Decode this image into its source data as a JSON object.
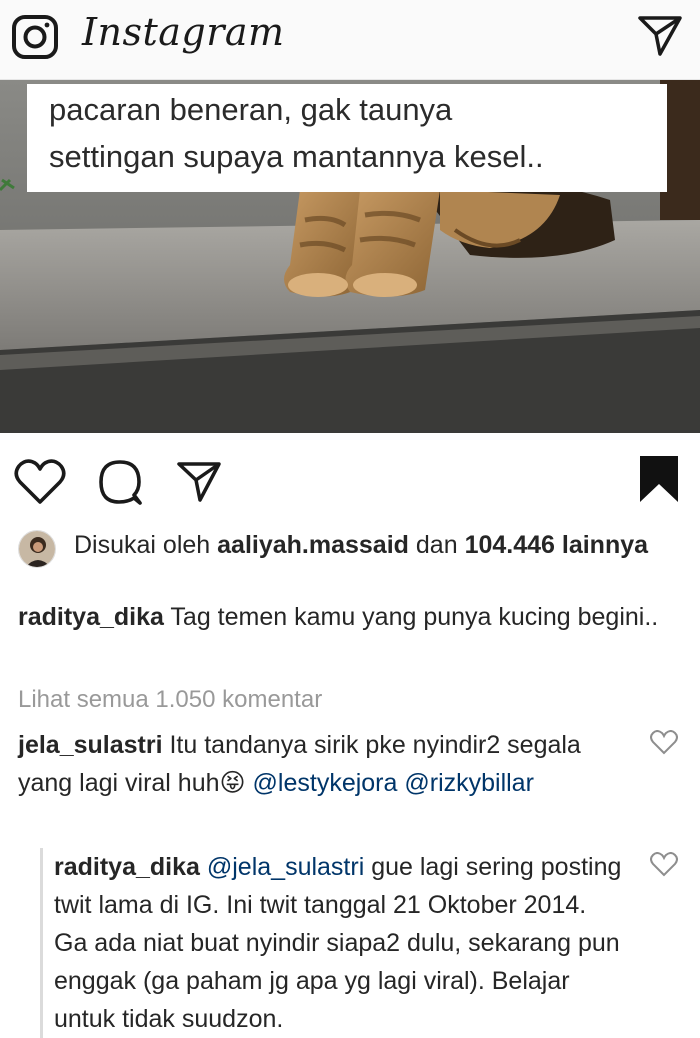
{
  "app": {
    "title": "Instagram"
  },
  "icons": {
    "camera": "camera-icon",
    "direct": "paper-plane-icon",
    "like": "heart-icon",
    "comment": "comment-bubble-icon",
    "share": "paper-plane-icon",
    "save": "bookmark-icon"
  },
  "post": {
    "image_text": [
      "pacaran beneran, gak taunya",
      "settingan supaya mantannya kesel.."
    ]
  },
  "likes": {
    "prefix": "Disukai oleh",
    "user": "aaliyah.massaid",
    "conj": "dan",
    "count": "104.446",
    "suffix": "lainnya"
  },
  "caption": {
    "user": "raditya_dika",
    "text": "Tag temen kamu yang punya kucing begini.."
  },
  "view_all": "Lihat semua 1.050 komentar",
  "comments": [
    {
      "user": "jela_sulastri",
      "text": "Itu tandanya sirik pke nyindir2 segala  yang lagi viral huh",
      "emoji": "😝",
      "mentions": [
        "@lestykejora",
        "@rizkybillar"
      ]
    }
  ],
  "reply": {
    "user": "raditya_dika",
    "mention": "@jela_sulastri",
    "text": "gue lagi sering posting twit lama di IG. Ini twit tanggal  21 Oktober 2014. Ga ada niat buat nyindir siapa2 dulu, sekarang pun enggak (ga paham jg apa yg lagi viral). Belajar untuk tidak suudzon."
  },
  "colors": {
    "mention": "#003569",
    "muted": "#999999",
    "text": "#262626"
  }
}
